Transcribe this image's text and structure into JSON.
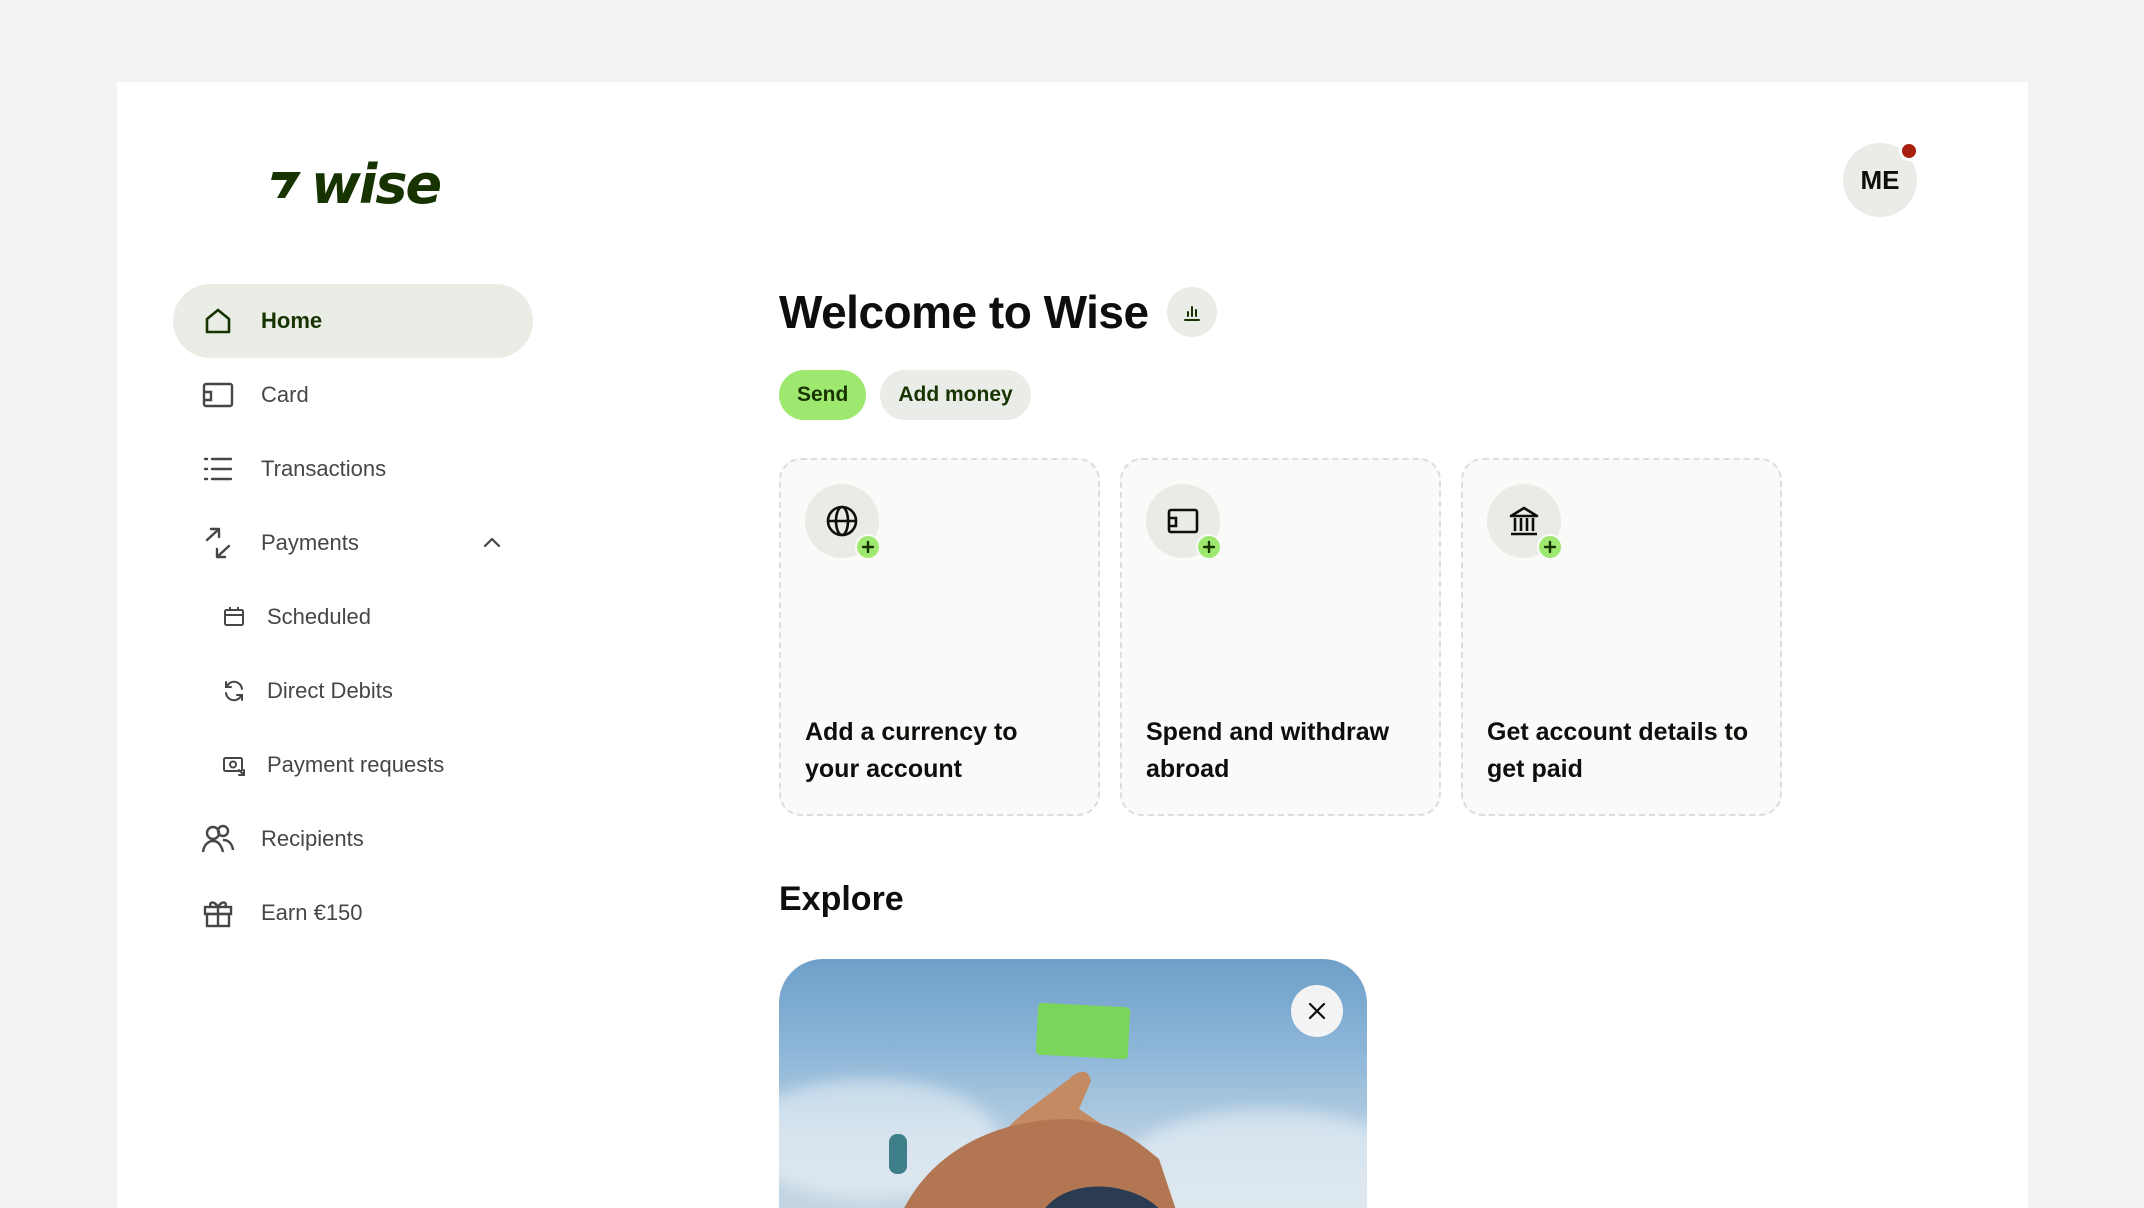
{
  "brand": {
    "name": "wise",
    "accent": "#9fe870",
    "dark": "#163300"
  },
  "user": {
    "initials": "ME",
    "has_notification": true
  },
  "sidebar": {
    "items": [
      {
        "label": "Home",
        "icon": "home-icon",
        "active": true
      },
      {
        "label": "Card",
        "icon": "card-icon"
      },
      {
        "label": "Transactions",
        "icon": "list-icon"
      },
      {
        "label": "Payments",
        "icon": "payments-arrows-icon",
        "expanded": true
      },
      {
        "label": "Scheduled",
        "icon": "calendar-icon",
        "sub": true
      },
      {
        "label": "Direct Debits",
        "icon": "refresh-icon",
        "sub": true
      },
      {
        "label": "Payment requests",
        "icon": "payment-request-icon",
        "sub": true
      },
      {
        "label": "Recipients",
        "icon": "people-icon"
      },
      {
        "label": "Earn €150",
        "icon": "gift-icon"
      }
    ]
  },
  "main": {
    "title": "Welcome to Wise",
    "actions": {
      "send": "Send",
      "add_money": "Add money"
    },
    "cards": [
      {
        "text": "Add a currency to your account",
        "icon": "globe-icon"
      },
      {
        "text": "Spend and withdraw abroad",
        "icon": "card-icon"
      },
      {
        "text": "Get account details to get paid",
        "icon": "bank-icon"
      }
    ],
    "explore": {
      "title": "Explore"
    }
  }
}
